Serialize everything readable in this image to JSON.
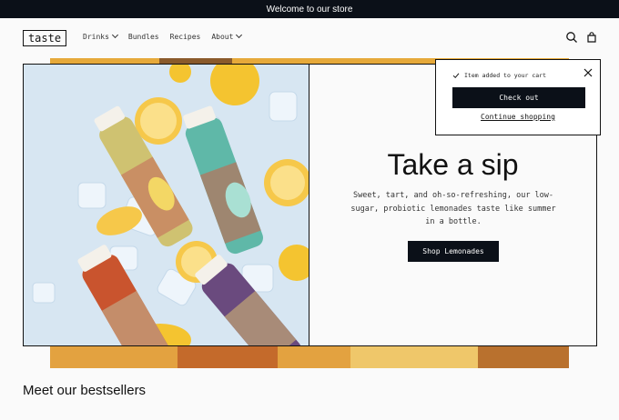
{
  "announcement": "Welcome to our store",
  "header": {
    "logo": "taste",
    "nav": [
      {
        "label": "Drinks",
        "dropdown": true
      },
      {
        "label": "Bundles",
        "dropdown": false
      },
      {
        "label": "Recipes",
        "dropdown": false
      },
      {
        "label": "About",
        "dropdown": true
      }
    ],
    "icons": [
      "search-icon",
      "cart-icon"
    ]
  },
  "hero": {
    "title": "Take a sip",
    "text": "Sweet, tart, and oh-so-refreshing, our low-sugar, probiotic lemonades taste like summer in a bottle.",
    "button": "Shop Lemonades"
  },
  "cart_popup": {
    "message": "Item added to your cart",
    "checkout": "Check out",
    "continue": "Continue shopping"
  },
  "section_title": "Meet our bestsellers",
  "colors": {
    "dark": "#0b1018",
    "background": "#fafafa",
    "accent_yellow": "#f4c430"
  }
}
